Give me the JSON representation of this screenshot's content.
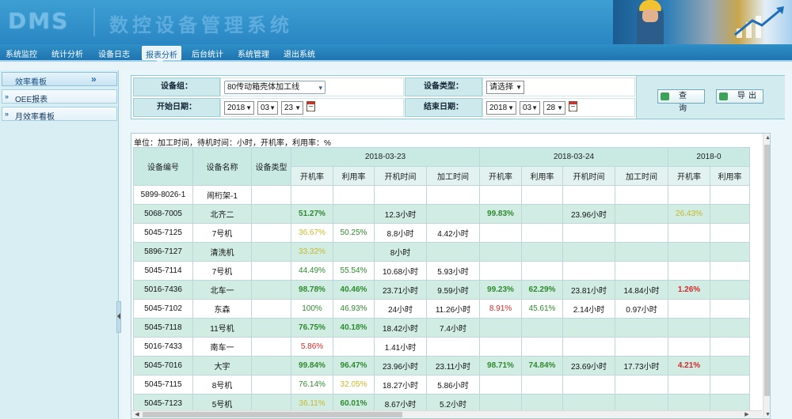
{
  "banner": {
    "logo_text": "DMS",
    "title_text": "数控设备管理系统"
  },
  "nav": {
    "items": [
      "系统监控",
      "统计分析",
      "设备日志",
      "报表分析",
      "后台统计",
      "系统管理",
      "退出系统"
    ],
    "active": "报表分析"
  },
  "sidebar": {
    "head": "效率看板",
    "items": [
      "OEE报表",
      "月效率看板"
    ]
  },
  "filter": {
    "group_label": "设备组：",
    "group_value": "80传动箱壳体加工线",
    "type_label": "设备类型：",
    "type_value": "请选择",
    "start_label": "开始日期：",
    "start_year": "2018",
    "start_month": "03",
    "start_day": "23",
    "end_label": "结束日期：",
    "end_year": "2018",
    "end_month": "03",
    "end_day": "28",
    "query_label": "查 询",
    "export_label": "导出"
  },
  "report": {
    "unit_note": "单位：加工时间，待机时间：小时，开机率，利用率：%",
    "col_headers": {
      "code": "设备编号",
      "name": "设备名称",
      "type": "设备类型"
    },
    "dates": [
      "2018-03-23",
      "2018-03-24",
      "2018-0"
    ],
    "metric_headers": [
      "开机率",
      "利用率",
      "开机时间",
      "加工时间"
    ],
    "rows": [
      {
        "code": "5899-8026-1",
        "name": "闹桁架-1",
        "cells": [
          [
            "",
            ""
          ],
          [
            "",
            ""
          ],
          [
            "",
            ""
          ],
          [
            "",
            ""
          ],
          [
            "",
            ""
          ],
          [
            "",
            ""
          ],
          [
            "",
            ""
          ],
          [
            "",
            ""
          ],
          [
            "",
            ""
          ],
          [
            "",
            ""
          ]
        ]
      },
      {
        "code": "5068-7005",
        "name": "北齐二",
        "cells": [
          [
            "51.27%",
            "greenb"
          ],
          [
            "",
            ""
          ],
          [
            "12.3小时",
            "black"
          ],
          [
            "",
            ""
          ],
          [
            "99.83%",
            "greenb"
          ],
          [
            "",
            ""
          ],
          [
            "23.96小时",
            "black"
          ],
          [
            "",
            ""
          ],
          [
            "26.43%",
            "yellow"
          ],
          [
            "",
            ""
          ]
        ]
      },
      {
        "code": "5045-7125",
        "name": "7号机",
        "cells": [
          [
            "36.67%",
            "yellow"
          ],
          [
            "50.25%",
            "green"
          ],
          [
            "8.8小时",
            "black"
          ],
          [
            "4.42小时",
            "black"
          ],
          [
            "",
            ""
          ],
          [
            "",
            ""
          ],
          [
            "",
            ""
          ],
          [
            "",
            ""
          ],
          [
            "",
            ""
          ],
          [
            "",
            ""
          ]
        ]
      },
      {
        "code": "5896-7127",
        "name": "清洗机",
        "cells": [
          [
            "33.32%",
            "yellow"
          ],
          [
            "",
            ""
          ],
          [
            "8小时",
            "black"
          ],
          [
            "",
            ""
          ],
          [
            "",
            ""
          ],
          [
            "",
            ""
          ],
          [
            "",
            ""
          ],
          [
            "",
            ""
          ],
          [
            "",
            ""
          ],
          [
            "",
            ""
          ]
        ]
      },
      {
        "code": "5045-7114",
        "name": "7号机",
        "cells": [
          [
            "44.49%",
            "green"
          ],
          [
            "55.54%",
            "green"
          ],
          [
            "10.68小时",
            "black"
          ],
          [
            "5.93小时",
            "black"
          ],
          [
            "",
            ""
          ],
          [
            "",
            ""
          ],
          [
            "",
            ""
          ],
          [
            "",
            ""
          ],
          [
            "",
            ""
          ],
          [
            "",
            ""
          ]
        ]
      },
      {
        "code": "5016-7436",
        "name": "北车一",
        "cells": [
          [
            "98.78%",
            "greenb"
          ],
          [
            "40.46%",
            "greenb"
          ],
          [
            "23.71小时",
            "black"
          ],
          [
            "9.59小时",
            "black"
          ],
          [
            "99.23%",
            "greenb"
          ],
          [
            "62.29%",
            "greenb"
          ],
          [
            "23.81小时",
            "black"
          ],
          [
            "14.84小时",
            "black"
          ],
          [
            "1.26%",
            "redb"
          ],
          [
            "",
            ""
          ]
        ]
      },
      {
        "code": "5045-7102",
        "name": "东森",
        "cells": [
          [
            "100%",
            "green"
          ],
          [
            "46.93%",
            "green"
          ],
          [
            "24小时",
            "black"
          ],
          [
            "11.26小时",
            "black"
          ],
          [
            "8.91%",
            "red"
          ],
          [
            "45.61%",
            "green"
          ],
          [
            "2.14小时",
            "black"
          ],
          [
            "0.97小时",
            "black"
          ],
          [
            "",
            ""
          ],
          [
            "",
            ""
          ]
        ]
      },
      {
        "code": "5045-7118",
        "name": "11号机",
        "cells": [
          [
            "76.75%",
            "greenb"
          ],
          [
            "40.18%",
            "greenb"
          ],
          [
            "18.42小时",
            "black"
          ],
          [
            "7.4小时",
            "black"
          ],
          [
            "",
            ""
          ],
          [
            "",
            ""
          ],
          [
            "",
            ""
          ],
          [
            "",
            ""
          ],
          [
            "",
            ""
          ],
          [
            "",
            ""
          ]
        ]
      },
      {
        "code": "5016-7433",
        "name": "南车一",
        "cells": [
          [
            "5.86%",
            "red"
          ],
          [
            "",
            ""
          ],
          [
            "1.41小时",
            "black"
          ],
          [
            "",
            ""
          ],
          [
            "",
            ""
          ],
          [
            "",
            ""
          ],
          [
            "",
            ""
          ],
          [
            "",
            ""
          ],
          [
            "",
            ""
          ],
          [
            "",
            ""
          ]
        ]
      },
      {
        "code": "5045-7016",
        "name": "大宇",
        "cells": [
          [
            "99.84%",
            "greenb"
          ],
          [
            "96.47%",
            "greenb"
          ],
          [
            "23.96小时",
            "black"
          ],
          [
            "23.11小时",
            "black"
          ],
          [
            "98.71%",
            "greenb"
          ],
          [
            "74.84%",
            "greenb"
          ],
          [
            "23.69小时",
            "black"
          ],
          [
            "17.73小时",
            "black"
          ],
          [
            "4.21%",
            "redb"
          ],
          [
            "",
            ""
          ]
        ]
      },
      {
        "code": "5045-7115",
        "name": "8号机",
        "cells": [
          [
            "76.14%",
            "green"
          ],
          [
            "32.05%",
            "yellow"
          ],
          [
            "18.27小时",
            "black"
          ],
          [
            "5.86小时",
            "black"
          ],
          [
            "",
            ""
          ],
          [
            "",
            ""
          ],
          [
            "",
            ""
          ],
          [
            "",
            ""
          ],
          [
            "",
            ""
          ],
          [
            "",
            ""
          ]
        ]
      },
      {
        "code": "5045-7123",
        "name": "5号机",
        "cells": [
          [
            "36.11%",
            "yellow"
          ],
          [
            "60.01%",
            "greenb"
          ],
          [
            "8.67小时",
            "black"
          ],
          [
            "5.2小时",
            "black"
          ],
          [
            "",
            ""
          ],
          [
            "",
            ""
          ],
          [
            "",
            ""
          ],
          [
            "",
            ""
          ],
          [
            "",
            ""
          ],
          [
            "",
            ""
          ]
        ]
      }
    ]
  }
}
